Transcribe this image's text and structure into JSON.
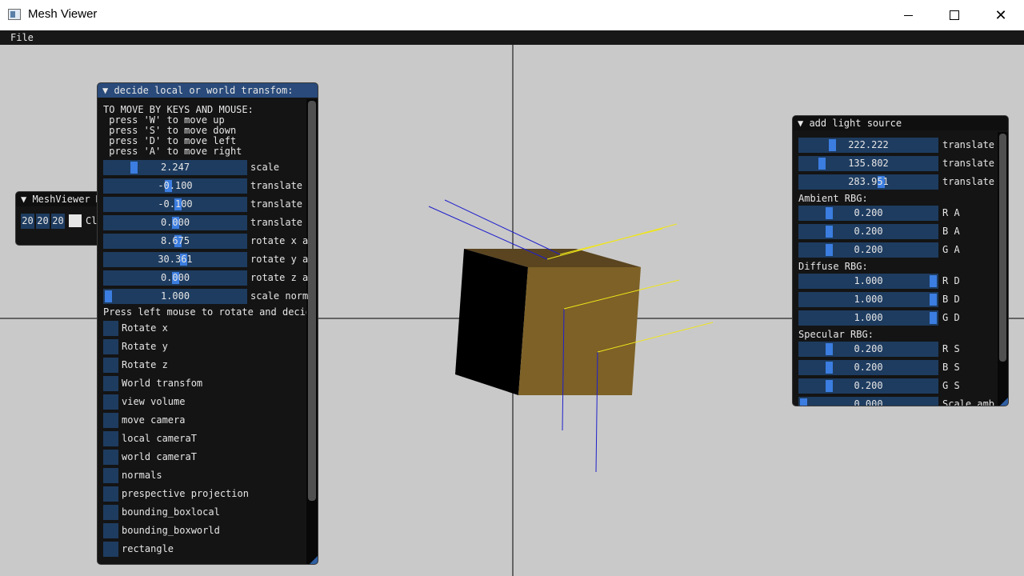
{
  "window": {
    "title": "Mesh Viewer",
    "minimize_icon": "minimize-icon",
    "maximize_icon": "maximize-icon",
    "close_icon": "close-icon",
    "close_glyph": "✕"
  },
  "menu": {
    "file": "File"
  },
  "transform_panel": {
    "title": "▼ decide local or world transfom:",
    "instructions": [
      "TO MOVE BY KEYS AND MOUSE:",
      " press 'W' to move up",
      " press 'S' to move down",
      " press 'D' to move left",
      " press 'A' to move right"
    ],
    "sliders": [
      {
        "value": "2.247",
        "label": "scale",
        "fill": 0.19
      },
      {
        "value": "-0.100",
        "label": "translate",
        "fill": 0.45
      },
      {
        "value": "-0.100",
        "label": "translate",
        "fill": 0.52
      },
      {
        "value": "0.000",
        "label": "translate",
        "fill": 0.5
      },
      {
        "value": "8.675",
        "label": "rotate x a",
        "fill": 0.52
      },
      {
        "value": "30.361",
        "label": "rotate y a",
        "fill": 0.56
      },
      {
        "value": "0.000",
        "label": "rotate z a",
        "fill": 0.5
      },
      {
        "value": "1.000",
        "label": "scale norm",
        "fill": 0.0
      }
    ],
    "hint": "Press left mouse to rotate and decid",
    "checkboxes": [
      "Rotate x",
      "Rotate y",
      "Rotate z",
      "World transfom",
      "view volume",
      "move camera",
      "local cameraT",
      "world cameraT",
      "normals",
      "prespective projection",
      "bounding_boxlocal",
      "bounding_boxworld",
      "rectangle"
    ]
  },
  "meshviewer_panel": {
    "title": "▼ MeshViewer M",
    "color_values": [
      "20",
      "20",
      "20"
    ],
    "clear_label": "Cl"
  },
  "light_panel": {
    "title": "▼ add light source",
    "translate_sliders": [
      {
        "value": "222.222",
        "label": "translate",
        "fill": 0.22
      },
      {
        "value": "135.802",
        "label": "translate",
        "fill": 0.14
      },
      {
        "value": "283.951",
        "label": "translate",
        "fill": 0.6
      }
    ],
    "sections": [
      {
        "title": "Ambient RBG:",
        "sliders": [
          {
            "value": "0.200",
            "label": "R A",
            "fill": 0.2
          },
          {
            "value": "0.200",
            "label": "B A",
            "fill": 0.2
          },
          {
            "value": "0.200",
            "label": "G A",
            "fill": 0.2
          }
        ]
      },
      {
        "title": "Diffuse RBG:",
        "sliders": [
          {
            "value": "1.000",
            "label": "R D",
            "fill": 1.0
          },
          {
            "value": "1.000",
            "label": "B D",
            "fill": 1.0
          },
          {
            "value": "1.000",
            "label": "G D",
            "fill": 1.0
          }
        ]
      },
      {
        "title": "Specular RBG:",
        "sliders": [
          {
            "value": "0.200",
            "label": "R S",
            "fill": 0.2
          },
          {
            "value": "0.200",
            "label": "B S",
            "fill": 0.2
          },
          {
            "value": "0.200",
            "label": "G S",
            "fill": 0.2
          }
        ]
      }
    ],
    "partial_row": {
      "value": "0.000",
      "label": "Scale amb"
    }
  },
  "colors": {
    "panel_bg": "#141414",
    "title_active": "#294a7a",
    "frame_bg": "#1e3c60",
    "grab": "#3b7de0",
    "viewport": "#c9c9c9",
    "cube_front": "#7d6127",
    "cube_top": "#5a4520",
    "cube_side": "#000000",
    "normal_line": "#2020cc",
    "light_line": "#f0e61a"
  }
}
